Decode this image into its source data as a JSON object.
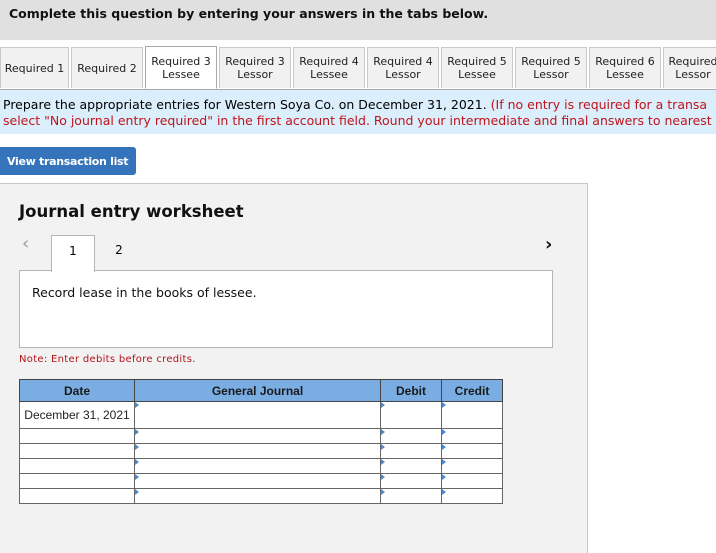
{
  "header": {
    "title": "Complete this question by entering your answers in the tabs below."
  },
  "tabs": [
    {
      "line1": "Required 1",
      "line2": "",
      "active": false
    },
    {
      "line1": "Required 2",
      "line2": "",
      "active": false
    },
    {
      "line1": "Required 3",
      "line2": "Lessee",
      "active": true
    },
    {
      "line1": "Required 3",
      "line2": "Lessor",
      "active": false
    },
    {
      "line1": "Required 4",
      "line2": "Lessee",
      "active": false
    },
    {
      "line1": "Required 4",
      "line2": "Lessor",
      "active": false
    },
    {
      "line1": "Required 5",
      "line2": "Lessee",
      "active": false
    },
    {
      "line1": "Required 5",
      "line2": "Lessor",
      "active": false
    },
    {
      "line1": "Required 6",
      "line2": "Lessee",
      "active": false
    },
    {
      "line1": "Required",
      "line2": "Lessor",
      "active": false
    }
  ],
  "instructions": {
    "line1_black": "Prepare the appropriate entries for Western Soya Co. on December 31, 2021. ",
    "line1_red": "(If no entry is required for a transa",
    "line2_red": "select \"No journal entry required\" in the first account field. Round your intermediate and final answers to nearest"
  },
  "view_transaction_button": "View transaction list",
  "worksheet": {
    "title": "Journal entry worksheet",
    "prev_icon": "‹",
    "next_icon": "›",
    "pages": [
      "1",
      "2"
    ],
    "active_page": "1",
    "description": "Record lease in the books of lessee.",
    "note": "Note: Enter debits before credits.",
    "table": {
      "headers": [
        "Date",
        "General Journal",
        "Debit",
        "Credit"
      ],
      "rows": [
        {
          "date": "December 31, 2021",
          "account": "",
          "debit": "",
          "credit": ""
        },
        {
          "date": "",
          "account": "",
          "debit": "",
          "credit": ""
        },
        {
          "date": "",
          "account": "",
          "debit": "",
          "credit": ""
        },
        {
          "date": "",
          "account": "",
          "debit": "",
          "credit": ""
        },
        {
          "date": "",
          "account": "",
          "debit": "",
          "credit": ""
        },
        {
          "date": "",
          "account": "",
          "debit": "",
          "credit": ""
        }
      ]
    }
  },
  "colors": {
    "accent_button": "#3574bb",
    "table_header": "#7aaee3",
    "instruction_bg": "#dbeefb",
    "note_red": "#c0141b"
  }
}
